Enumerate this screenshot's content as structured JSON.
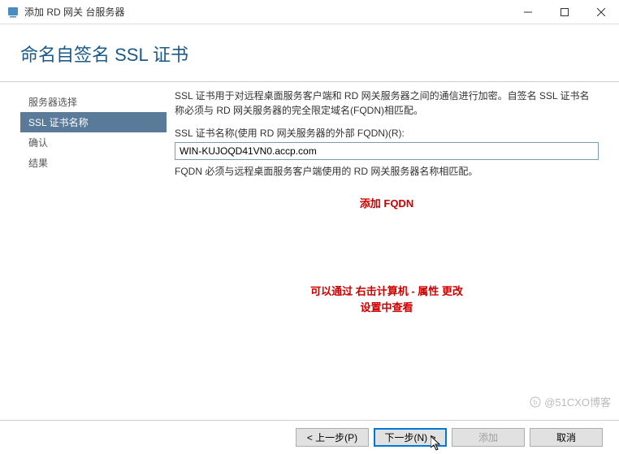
{
  "window": {
    "title": "添加 RD 网关 台服务器"
  },
  "header": {
    "title": "命名自签名 SSL 证书"
  },
  "sidebar": {
    "items": [
      {
        "label": "服务器选择"
      },
      {
        "label": "SSL 证书名称"
      },
      {
        "label": "确认"
      },
      {
        "label": "结果"
      }
    ]
  },
  "main": {
    "description": "SSL 证书用于对远程桌面服务客户端和 RD 网关服务器之间的通信进行加密。自签名 SSL 证书名称必须与 RD 网关服务器的完全限定域名(FQDN)相匹配。",
    "field_label": "SSL 证书名称(使用 RD 网关服务器的外部 FQDN)(R):",
    "field_value": "WIN-KUJOQD41VN0.accp.com",
    "hint": "FQDN 必须与远程桌面服务客户端使用的 RD 网关服务器名称相匹配。",
    "annotation1": "添加 FQDN",
    "annotation2_line1": "可以通过 右击计算机 - 属性  更改",
    "annotation2_line2": "设置中查看"
  },
  "footer": {
    "prev": "< 上一步(P)",
    "next": "下一步(N) >",
    "add": "添加",
    "cancel": "取消"
  },
  "watermark": "@51CXO博客"
}
